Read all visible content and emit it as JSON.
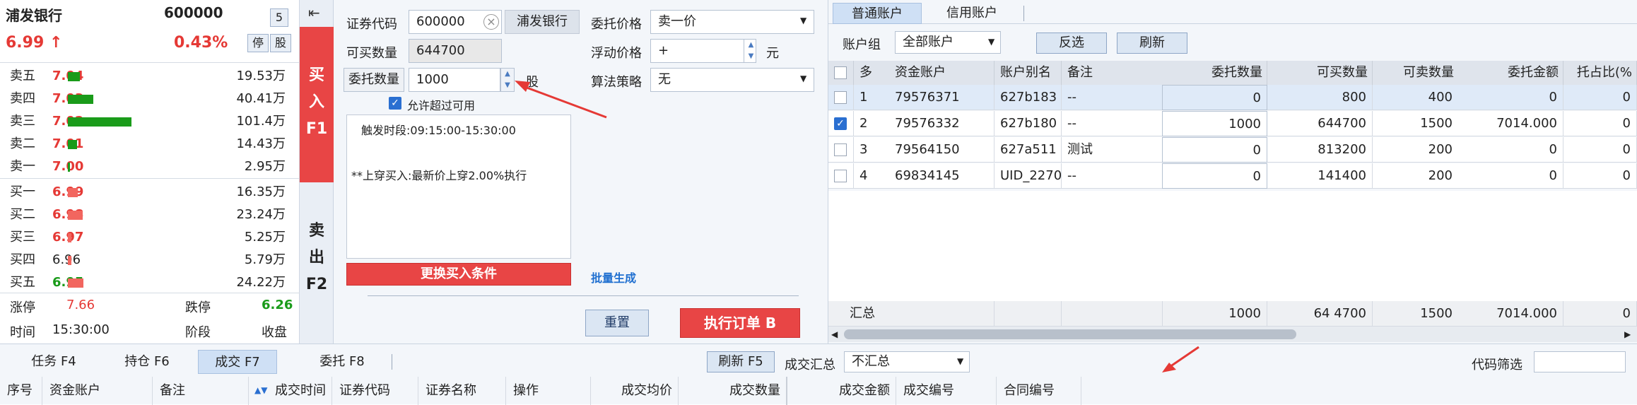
{
  "quote": {
    "name": "浦发银行",
    "code": "600000",
    "badge": "5",
    "price": "6.99",
    "arrow": "↑",
    "change_pct": "0.43%",
    "btn_stop": "停",
    "btn_stock": "股",
    "asks": [
      {
        "label": "卖五",
        "price": "7.04",
        "volume": "19.53万",
        "level": 0.19
      },
      {
        "label": "卖四",
        "price": "7.03",
        "volume": "40.41万",
        "level": 0.4
      },
      {
        "label": "卖三",
        "price": "7.02",
        "volume": "101.4万",
        "level": 1.0
      },
      {
        "label": "卖二",
        "price": "7.01",
        "volume": "14.43万",
        "level": 0.14
      },
      {
        "label": "卖一",
        "price": "7.00",
        "volume": "2.95万",
        "level": 0.03
      }
    ],
    "bids": [
      {
        "label": "买一",
        "price": "6.99",
        "volume": "16.35万",
        "level": 0.16
      },
      {
        "label": "买二",
        "price": "6.98",
        "volume": "23.24万",
        "level": 0.23
      },
      {
        "label": "买三",
        "price": "6.97",
        "volume": "5.25万",
        "level": 0.05
      },
      {
        "label": "买四",
        "price": "6.96",
        "volume": "5.79万",
        "level": 0.06
      },
      {
        "label": "买五",
        "price": "6.95",
        "volume": "24.22万",
        "level": 0.24
      }
    ],
    "limit_up_label": "涨停",
    "limit_up": "7.66",
    "limit_down_label": "跌停",
    "limit_down": "6.26",
    "time_label": "时间",
    "time": "15:30:00",
    "phase_label": "阶段",
    "phase": "收盘"
  },
  "side_tabs": {
    "collapse_icon": "collapse-left-icon",
    "buy": [
      "买",
      "入",
      "F1"
    ],
    "sell": [
      "卖",
      "出",
      "F2"
    ]
  },
  "order": {
    "code_label": "证券代码",
    "code_value": "600000",
    "code_name": "浦发银行",
    "available_label": "可买数量",
    "available_value": "644700",
    "qty_label": "委托数量",
    "qty_value": "1000",
    "qty_unit": "股",
    "allow_exceed_label": "允许超过可用",
    "price_label": "委托价格",
    "price_value": "卖一价",
    "float_label": "浮动价格",
    "float_value": "+",
    "float_unit": "元",
    "algo_label": "算法策略",
    "algo_value": "无",
    "condition_line1": "触发时段:09:15:00-15:30:00",
    "condition_line2": "**上穿买入:最新价上穿2.00%执行",
    "change_condition": "更换买入条件",
    "batch": "批量生成",
    "reset": "重置",
    "execute": "执行订单 B"
  },
  "accounts": {
    "tabs": [
      "普通账户",
      "信用账户"
    ],
    "group_label": "账户组",
    "group_value": "全部账户",
    "invert": "反选",
    "refresh": "刷新",
    "columns": [
      "多",
      "资金账户",
      "账户别名",
      "备注",
      "委托数量",
      "可买数量",
      "可卖数量",
      "委托金额",
      "托占比(%总"
    ],
    "rows": [
      {
        "checked": false,
        "idx": "1",
        "account": "79576371",
        "alias": "627b183",
        "note": "--",
        "qty": "0",
        "buyable": "800",
        "sellable": "400",
        "amount": "0",
        "ratio": "0"
      },
      {
        "checked": true,
        "idx": "2",
        "account": "79576332",
        "alias": "627b180",
        "note": "--",
        "qty": "1000",
        "buyable": "644700",
        "sellable": "1500",
        "amount": "7014.000",
        "ratio": "0"
      },
      {
        "checked": false,
        "idx": "3",
        "account": "79564150",
        "alias": "627a511",
        "note": "测试",
        "qty": "0",
        "buyable": "813200",
        "sellable": "200",
        "amount": "0",
        "ratio": "0"
      },
      {
        "checked": false,
        "idx": "4",
        "account": "69834145",
        "alias": "UID_2270",
        "note": "--",
        "qty": "0",
        "buyable": "141400",
        "sellable": "200",
        "amount": "0",
        "ratio": "0"
      }
    ],
    "summary_label": "汇总",
    "summary": {
      "qty": "1000",
      "buyable": "64 4700",
      "sellable": "1500",
      "amount": "7014.000",
      "ratio": "0"
    }
  },
  "bottom": {
    "tabs": [
      "任务 F4",
      "持仓 F6",
      "成交 F7",
      "委托 F8"
    ],
    "refresh": "刷新 F5",
    "summary_label": "成交汇总",
    "summary_value": "不汇总",
    "filter_label": "代码筛选",
    "columns": [
      "序号",
      "资金账户",
      "备注",
      "成交时间",
      "证券代码",
      "证券名称",
      "操作",
      "成交均价",
      "成交数量",
      "成交金额",
      "成交编号",
      "合同编号"
    ]
  },
  "colors": {
    "red": "#e53935",
    "green": "#1a9b1a",
    "accent": "#cfe0f5"
  }
}
